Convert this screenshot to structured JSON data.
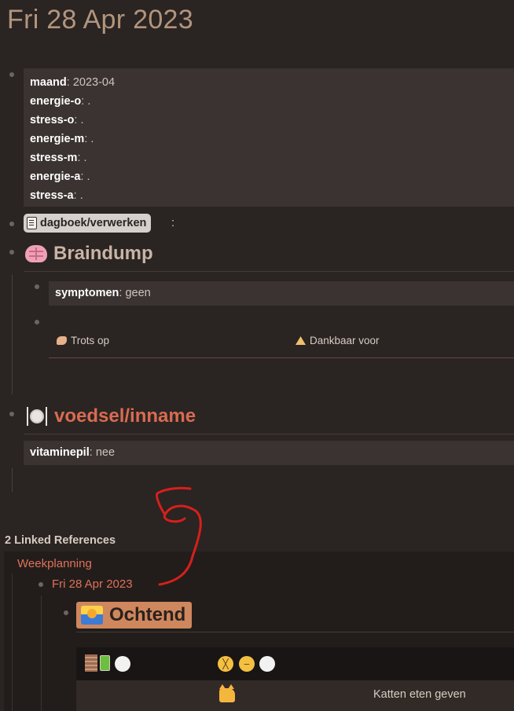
{
  "page": {
    "title": "Fri 28 Apr 2023"
  },
  "properties": [
    {
      "key": "maand",
      "value": "2023-04"
    },
    {
      "key": "energie-o",
      "value": "."
    },
    {
      "key": "stress-o",
      "value": "."
    },
    {
      "key": "energie-m",
      "value": "."
    },
    {
      "key": "stress-m",
      "value": "."
    },
    {
      "key": "energie-a",
      "value": "."
    },
    {
      "key": "stress-a",
      "value": "."
    }
  ],
  "tag": {
    "label": "dagboek/verwerken",
    "icon": "notebook-icon",
    "suffix": ":"
  },
  "braindump": {
    "icon": "brain-icon",
    "heading": "Braindump",
    "symptomen": {
      "key": "symptomen",
      "value": "geen"
    },
    "columns": [
      {
        "icon": "flexed-biceps-icon",
        "label": "Trots op"
      },
      {
        "icon": "folded-hands-icon",
        "label": "Dankbaar voor"
      }
    ]
  },
  "voedsel": {
    "icon": "plate-cutlery-icon",
    "heading": "voedsel/inname",
    "vitaminepil": {
      "key": "vitaminepil",
      "value": "nee"
    }
  },
  "linked": {
    "count_label": "2 Linked References",
    "page_link": "Weekplanning",
    "date_link": "Fri 28 Apr 2023",
    "ochtend": {
      "icon": "sunrise-icon",
      "label": "Ochtend"
    },
    "status_icons": [
      "bricks-icon",
      "battery-icon",
      "white-circle-icon",
      "confounded-face-icon",
      "pensive-face-icon",
      "white-circle-icon"
    ],
    "task": {
      "icon": "cat-icon",
      "label": "Katten eten geven"
    }
  },
  "colors": {
    "background": "#2a2422",
    "accent": "#d86b52",
    "title": "#b2957d",
    "block_bg": "#3a3331",
    "annotation_stroke": "#d6201b"
  }
}
